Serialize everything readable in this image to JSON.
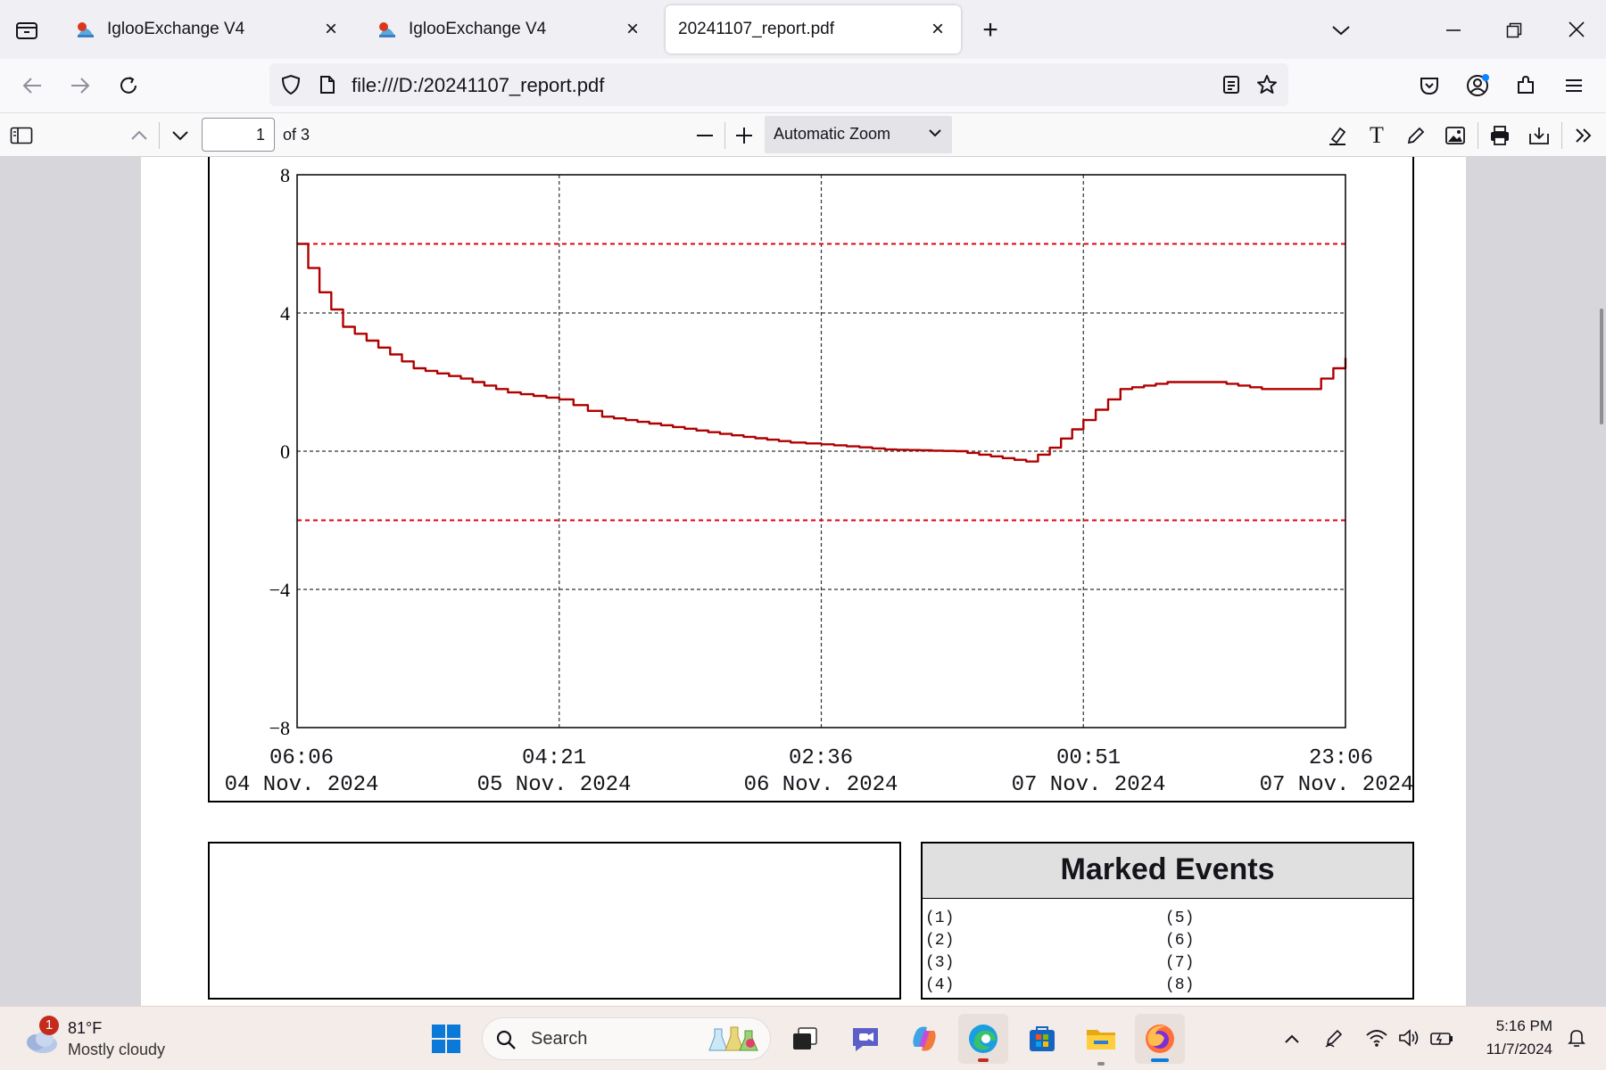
{
  "browser": {
    "tabs": [
      {
        "label": "IglooExchange V4",
        "active": false
      },
      {
        "label": "IglooExchange V4",
        "active": false
      },
      {
        "label": "20241107_report.pdf",
        "active": true
      }
    ],
    "url": "file:///D:/20241107_report.pdf"
  },
  "pdf_toolbar": {
    "page_number": "1",
    "page_count": "of 3",
    "zoom": "Automatic Zoom"
  },
  "report": {
    "y_ticks": [
      "8",
      "4",
      "0",
      "−4",
      "−8"
    ],
    "x_ticks": [
      {
        "time": "06:06",
        "date": "04 Nov. 2024"
      },
      {
        "time": "04:21",
        "date": "05 Nov. 2024"
      },
      {
        "time": "02:36",
        "date": "06 Nov. 2024"
      },
      {
        "time": "00:51",
        "date": "07 Nov. 2024"
      },
      {
        "time": "23:06",
        "date": "07 Nov. 2024"
      }
    ],
    "marked_events_title": "Marked Events",
    "events_left": [
      "(1)",
      "(2)",
      "(3)",
      "(4)"
    ],
    "events_right": [
      "(5)",
      "(6)",
      "(7)",
      "(8)"
    ]
  },
  "chart_data": {
    "type": "line",
    "x_start": "2024-11-04 06:06",
    "x_end": "2024-11-07 23:06",
    "ylim": [
      -8,
      8
    ],
    "yticks": [
      8,
      4,
      0,
      -4,
      -8
    ],
    "grid": true,
    "limit_lines": [
      6,
      -2
    ],
    "limit_line_color": "#e8000b",
    "series_color": "#b00000",
    "series": [
      {
        "x": [
          "2024-11-04 06:06",
          "2024-11-04 08:00",
          "2024-11-04 10:00",
          "2024-11-04 12:00",
          "2024-11-04 16:00",
          "2024-11-04 20:00",
          "2024-11-05 00:00",
          "2024-11-05 04:21",
          "2024-11-05 08:00",
          "2024-11-05 12:00",
          "2024-11-05 18:00",
          "2024-11-06 00:00",
          "2024-11-06 02:36",
          "2024-11-06 08:00",
          "2024-11-06 14:00",
          "2024-11-06 18:00",
          "2024-11-06 20:00",
          "2024-11-06 22:00",
          "2024-11-07 00:51",
          "2024-11-07 04:00",
          "2024-11-07 08:00",
          "2024-11-07 12:00",
          "2024-11-07 16:00",
          "2024-11-07 20:00",
          "2024-11-07 23:06"
        ],
        "y": [
          6.0,
          4.6,
          3.6,
          3.2,
          2.4,
          2.1,
          1.7,
          1.5,
          1.0,
          0.8,
          0.5,
          0.25,
          0.2,
          0.05,
          0.0,
          -0.2,
          -0.3,
          0.1,
          0.9,
          1.8,
          2.0,
          2.0,
          1.8,
          1.8,
          2.7
        ]
      }
    ]
  },
  "taskbar": {
    "weather_badge": "1",
    "temperature": "81°F",
    "weather_text": "Mostly cloudy",
    "search_placeholder": "Search",
    "time": "5:16 PM",
    "date": "11/7/2024"
  }
}
